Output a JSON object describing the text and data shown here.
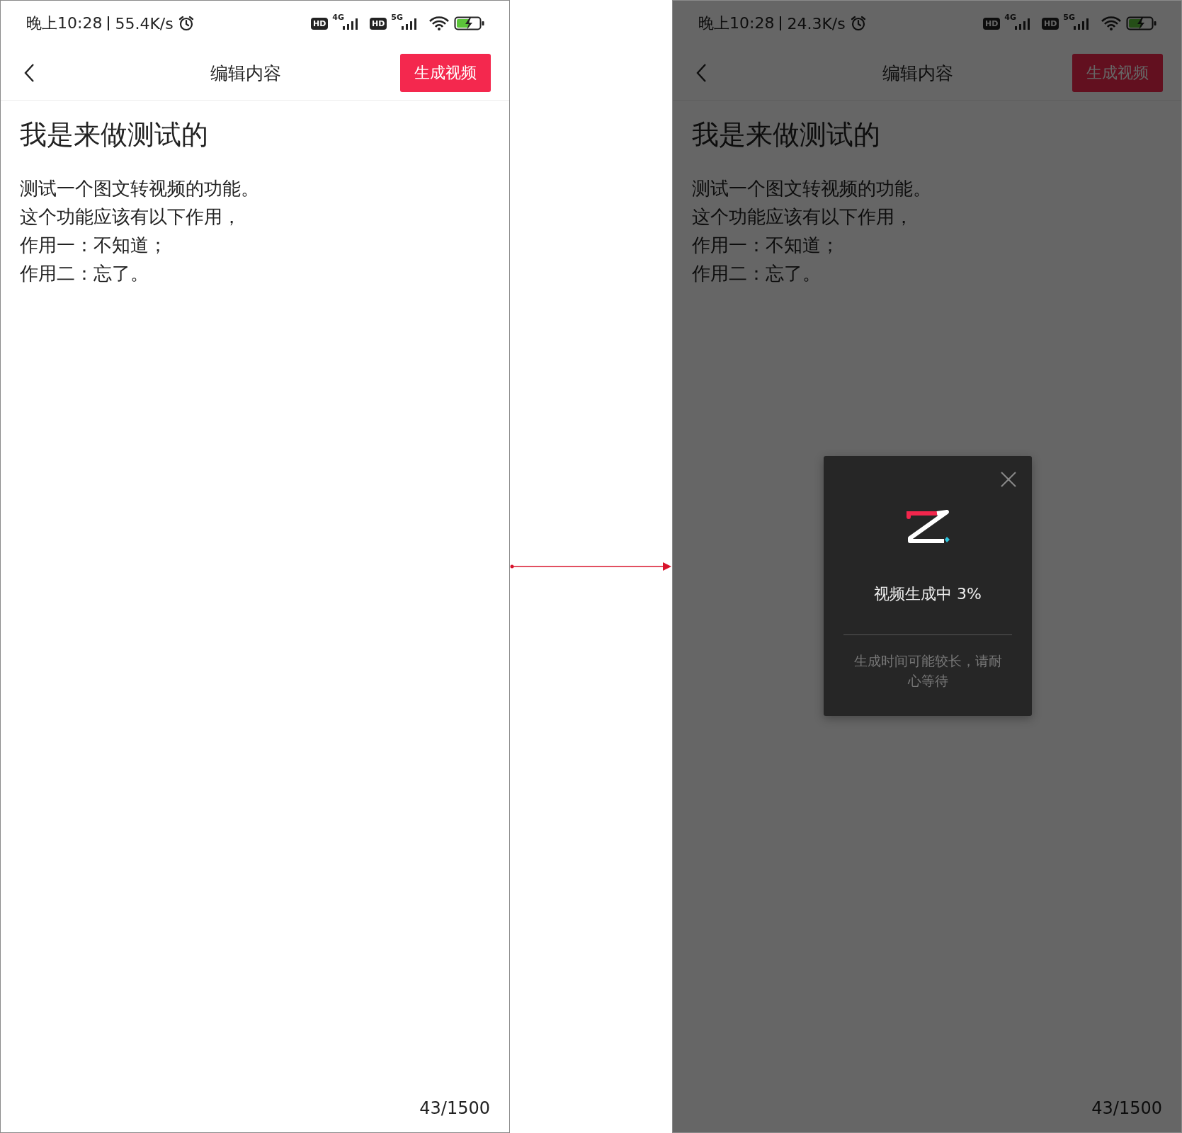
{
  "screens": [
    {
      "status_bar": {
        "time": "晚上10:28",
        "speed": "55.4K/s",
        "networks": [
          {
            "badge": "HD",
            "type": "4G"
          },
          {
            "badge": "HD",
            "type": "5G"
          }
        ]
      },
      "nav": {
        "title": "编辑内容",
        "action": "生成视频"
      },
      "editor": {
        "title": "我是来做测试的",
        "lines": [
          "测试一个图文转视频的功能。",
          "这个功能应该有以下作用，",
          "作用一：不知道；",
          "作用二：忘了。"
        ],
        "counter": "43/1500"
      }
    },
    {
      "status_bar": {
        "time": "晚上10:28",
        "speed": "24.3K/s",
        "networks": [
          {
            "badge": "HD",
            "type": "4G"
          },
          {
            "badge": "HD",
            "type": "5G"
          }
        ]
      },
      "nav": {
        "title": "编辑内容",
        "action": "生成视频"
      },
      "editor": {
        "title": "我是来做测试的",
        "lines": [
          "测试一个图文转视频的功能。",
          "这个功能应该有以下作用，",
          "作用一：不知道；",
          "作用二：忘了。"
        ],
        "counter": "43/1500"
      },
      "dialog": {
        "status": "视频生成中 3%",
        "note": "生成时间可能较长，请耐心等待"
      }
    }
  ]
}
